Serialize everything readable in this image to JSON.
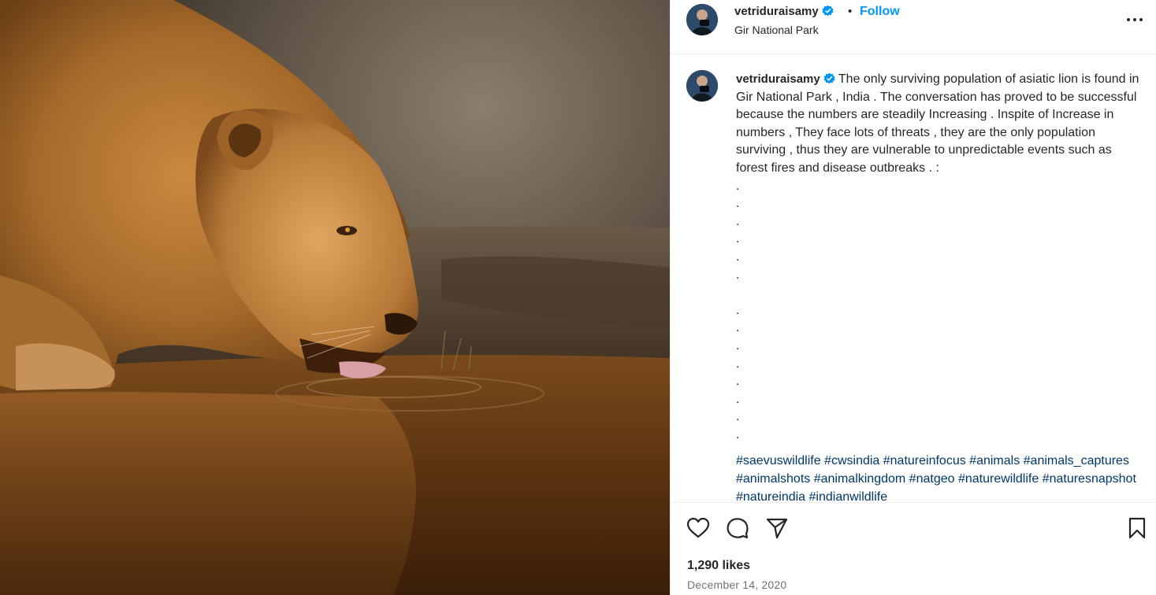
{
  "photo": {
    "alt_icon": "lion-drinking-photo"
  },
  "header": {
    "username": "vetriduraisamy",
    "separator": "•",
    "follow_label": "Follow",
    "location": "Gir National Park"
  },
  "caption": {
    "username": "vetriduraisamy",
    "text": "The only surviving population of asiatic lion is found in Gir National Park , India . The conversation has proved to be successful because the numbers are steadily Increasing . Inspite of Increase in numbers , They face lots of threats , they are the only population surviving , thus they are vulnerable to unpredictable events such as forest fires and disease outbreaks . :",
    "dots_group_1": ".\n.\n.\n.\n.\n.",
    "dots_group_2": ".\n.\n.\n.\n.\n.\n.\n.",
    "hashtags": "#saevuswildlife #cwsindia #natureinfocus #animals #animals_captures #animalshots #animalkingdom #natgeo #naturewildlife #naturesnapshot #natureindia #indianwildlife"
  },
  "actions": {
    "like_icon": "heart-icon",
    "comment_icon": "comment-icon",
    "share_icon": "send-icon",
    "save_icon": "bookmark-icon",
    "likes": "1,290 likes",
    "date": "December 14, 2020"
  },
  "colors": {
    "accent": "#0095f6",
    "hashtag": "#00376b",
    "verified": "#0095f6"
  }
}
